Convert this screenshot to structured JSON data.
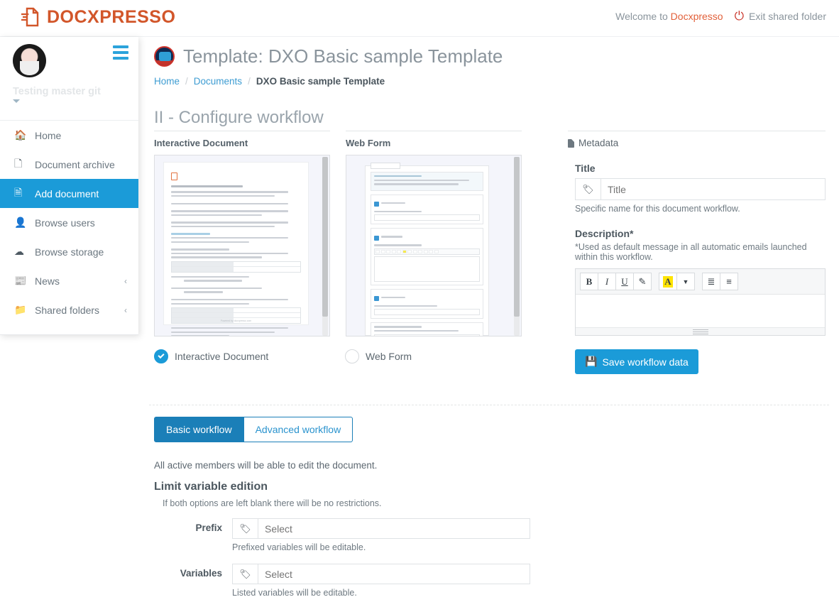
{
  "topbar": {
    "brand": "DOCXPRESSO",
    "brand_icon": "document-arrow-icon",
    "welcome_prefix": "Welcome to",
    "welcome_user": "Docxpresso",
    "exit_label": "Exit shared folder",
    "power_icon": "power-icon",
    "brand_color": "#d2562a",
    "accent_color": "#1b9bd8"
  },
  "sidebar": {
    "hamburger_icon": "hamburger-icon",
    "profile": {
      "name": "Testing master git",
      "avatar_icon": "user-avatar",
      "caret_icon": "caret-down-icon"
    },
    "items": [
      {
        "label": "Home",
        "icon": "home-icon",
        "glyph": "⌂",
        "active": false,
        "chevron": ""
      },
      {
        "label": "Document archive",
        "icon": "documents-icon",
        "glyph": "❐",
        "active": false,
        "chevron": ""
      },
      {
        "label": "Add document",
        "icon": "file-icon",
        "glyph": "὜B",
        "active": true,
        "chevron": ""
      },
      {
        "label": "Browse users",
        "icon": "user-icon",
        "glyph": "♟",
        "active": false,
        "chevron": ""
      },
      {
        "label": "Browse storage",
        "icon": "cloud-icon",
        "glyph": "☁",
        "active": false,
        "chevron": ""
      },
      {
        "label": "News",
        "icon": "news-icon",
        "glyph": "▤",
        "active": false,
        "chevron": "‹"
      },
      {
        "label": "Shared folders",
        "icon": "folder-icon",
        "glyph": "὜0",
        "active": false,
        "chevron": "‹"
      }
    ]
  },
  "header": {
    "logo_icon": "template-badge-logo",
    "title": "Template: DXO Basic sample Template",
    "breadcrumb": {
      "home": "Home",
      "documents": "Documents",
      "current": "DXO Basic sample Template",
      "separator": "/"
    }
  },
  "workflow": {
    "section_title": "II - Configure workflow",
    "previews": [
      {
        "header": "Interactive Document",
        "thumb_name": "interactive-document-preview"
      },
      {
        "header": "Web Form",
        "thumb_name": "web-form-preview"
      }
    ],
    "radios": [
      {
        "label": "Interactive Document",
        "selected": true
      },
      {
        "label": "Web Form",
        "selected": false
      }
    ]
  },
  "metadata": {
    "panel_title": "Metadata",
    "panel_icon": "file-icon",
    "title_label": "Title",
    "title_value": "",
    "title_placeholder": "Title",
    "title_addon_icon": "tag-icon",
    "title_helper": "Specific name for this document workflow.",
    "description_label": "Description*",
    "description_helper": "*Used as default message in all automatic emails launched within this workflow.",
    "editor_buttons": [
      {
        "name": "bold-button",
        "glyph": "B"
      },
      {
        "name": "italic-button",
        "glyph": "I"
      },
      {
        "name": "underline-button",
        "glyph": "U"
      },
      {
        "name": "remove-format-button",
        "glyph": "✒"
      },
      {
        "name": "text-color-button",
        "glyph": "A"
      },
      {
        "name": "text-color-dropdown-button",
        "glyph": "▾"
      },
      {
        "name": "unordered-list-button",
        "glyph": "☰"
      },
      {
        "name": "ordered-list-button",
        "glyph": "☷"
      }
    ],
    "description_value": "",
    "save_button": "Save workflow data",
    "save_icon": "floppy-disk-icon"
  },
  "lower": {
    "tabs": [
      {
        "label": "Basic workflow",
        "active": true
      },
      {
        "label": "Advanced workflow",
        "active": false
      }
    ],
    "note": "All active members will be able to edit the document.",
    "subtitle": "Limit variable edition",
    "hint": "If both options are left blank there will be no restrictions.",
    "fields": [
      {
        "label": "Prefix",
        "addon_icon": "tag-icon",
        "value": "",
        "placeholder": "Select",
        "helper": "Prefixed variables will be editable."
      },
      {
        "label": "Variables",
        "addon_icon": "tag-icon",
        "value": "",
        "placeholder": "Select",
        "helper": "Listed variables will be editable."
      }
    ]
  }
}
